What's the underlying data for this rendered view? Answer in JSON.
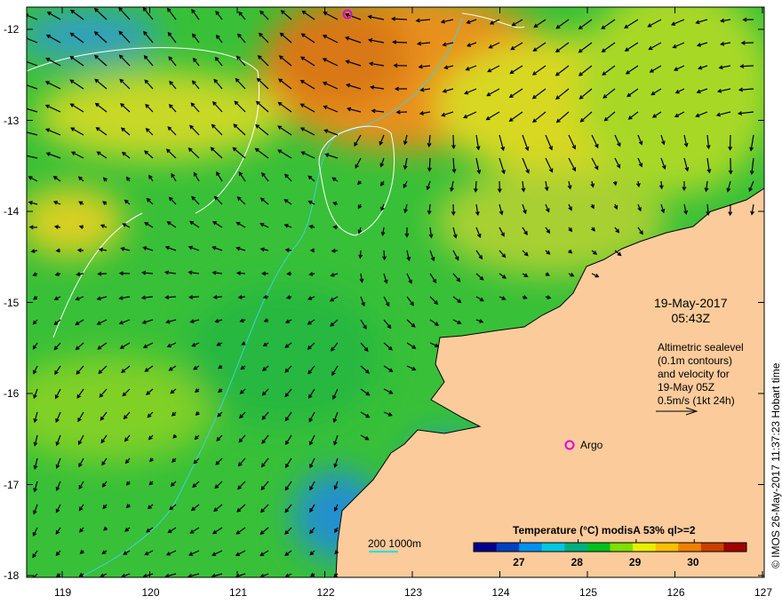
{
  "map": {
    "x_ticks": [
      "119",
      "120",
      "121",
      "122",
      "123",
      "124",
      "125",
      "126",
      "127"
    ],
    "y_ticks": [
      "-12",
      "-13",
      "-14",
      "-15",
      "-16",
      "-17",
      "-18"
    ],
    "date": "19-May-2017",
    "time": "05:43Z",
    "annotation": [
      "Altimetric sealevel",
      "(0.1m contours)",
      "and velocity for",
      "19-May 05Z",
      "0.5m/s (1kt 24h)"
    ],
    "argo_label": "Argo",
    "depth_legend": "200  1000m",
    "credit": "© IMOS 26-May-2017 11:37:23 Hobart time"
  },
  "colorbar": {
    "title": "Temperature (°C) modisA 53% ql>=2",
    "ticks": [
      "27",
      "28",
      "29",
      "30"
    ],
    "range": [
      26.2,
      30.9
    ],
    "colors": [
      "#00008b",
      "#0040c0",
      "#0090f0",
      "#00c8e0",
      "#00b080",
      "#00c020",
      "#80e000",
      "#e8f000",
      "#f8c000",
      "#f08000",
      "#c84000",
      "#a00000"
    ]
  }
}
